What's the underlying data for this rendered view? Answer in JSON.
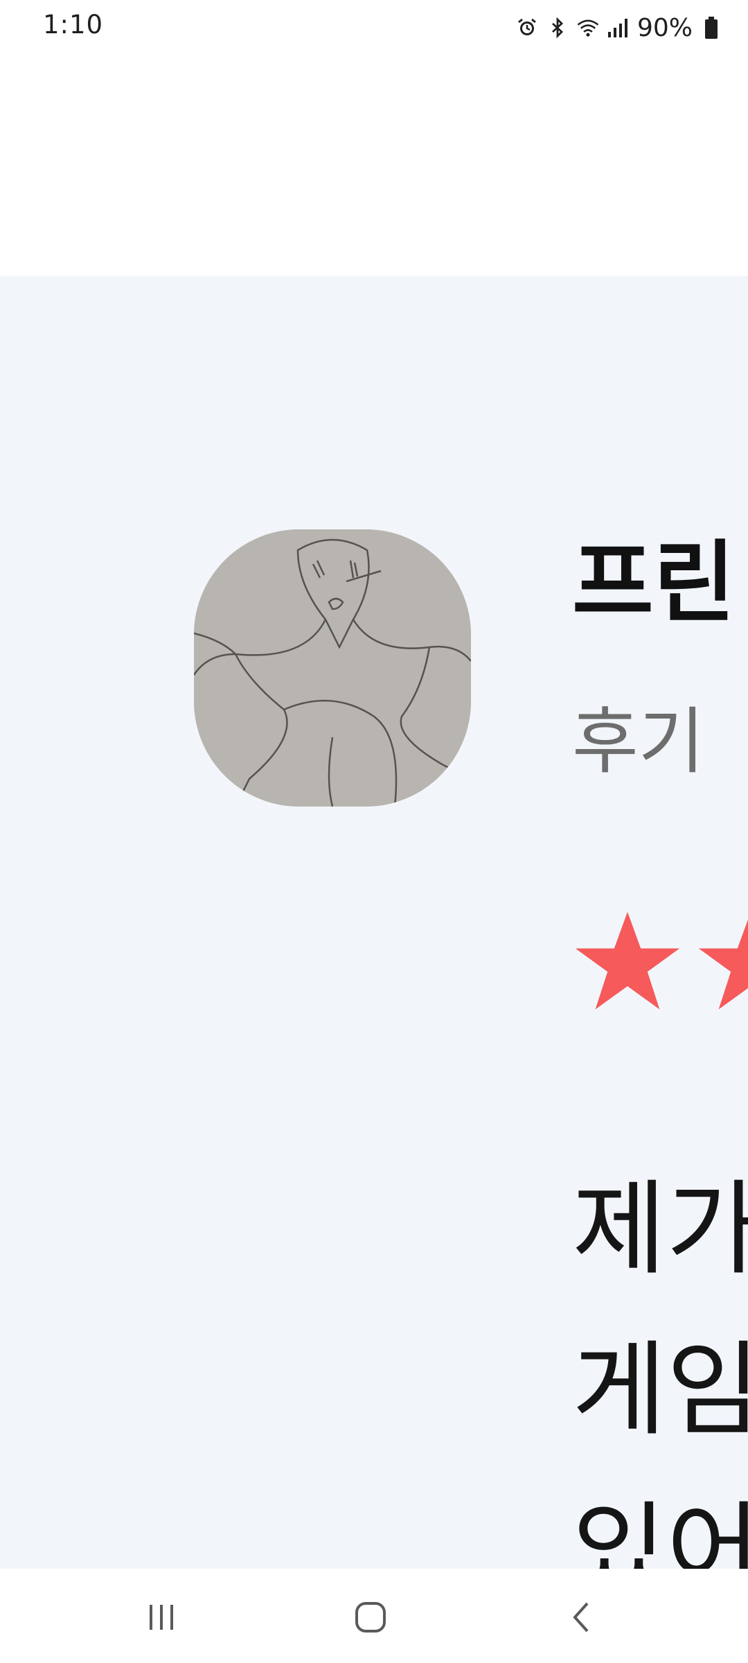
{
  "status_bar": {
    "time": "1:10",
    "battery": "90%",
    "icons": [
      "alarm-icon",
      "bluetooth-icon",
      "wifi-icon",
      "signal-icon",
      "battery-icon"
    ]
  },
  "review": {
    "title": "프린",
    "subtitle": "후기",
    "rating_stars_visible": 2,
    "star_color": "#f65a5b",
    "body_lines": [
      "제가",
      "게임",
      "있어"
    ]
  },
  "nav_bar": {
    "icons": [
      "recent-apps-icon",
      "home-icon",
      "back-icon"
    ]
  },
  "colors": {
    "content_background": "#f2f6fb",
    "title": "#111111",
    "subtitle": "#6d6d6d"
  }
}
